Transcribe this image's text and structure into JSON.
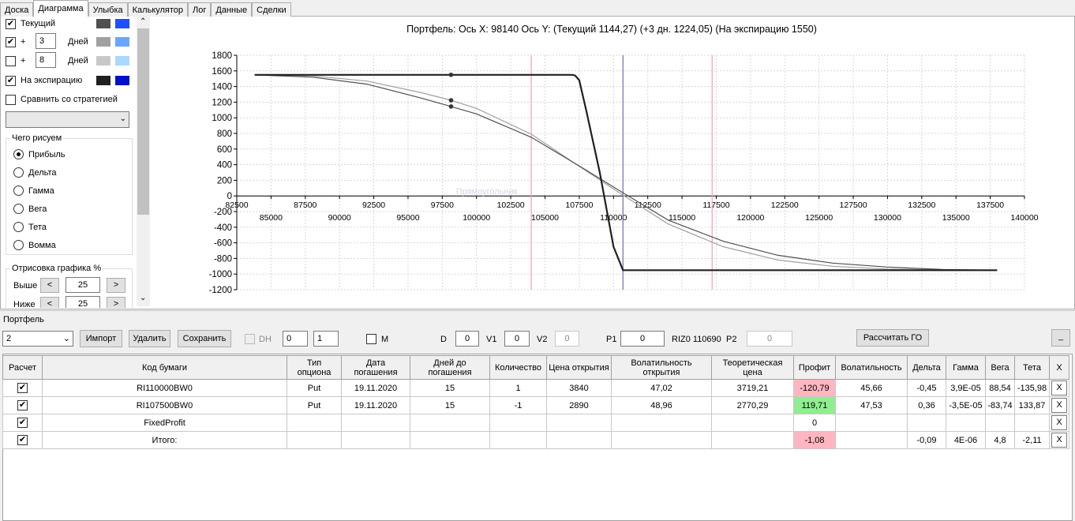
{
  "tabs": [
    "Доска",
    "Диаграмма",
    "Улыбка",
    "Калькулятор",
    "Лог",
    "Данные",
    "Сделки"
  ],
  "active_tab": 1,
  "left": {
    "current_label": "Текущий",
    "plus": "+",
    "days1": "3",
    "days2": "8",
    "days_label": "Дней",
    "expiry_label": "На экспирацию",
    "compare_label": "Сравнить со стратегией",
    "what_title": "Чего рисуем",
    "radios": [
      "Прибыль",
      "Дельта",
      "Гамма",
      "Вега",
      "Тета",
      "Вомма"
    ],
    "draw_title": "Отрисовка графика %",
    "above_label": "Выше",
    "below_label": "Ниже",
    "above_val": "25",
    "below_val": "25",
    "lt": "<",
    "gt": ">"
  },
  "colors": {
    "current": [
      "#505050",
      "#1f4fff"
    ],
    "plus3": [
      "#a0a0a0",
      "#6aa6ff"
    ],
    "plus8": [
      "#c8c8c8",
      "#aad8ff"
    ],
    "expiry": [
      "#202020",
      "#0010c8"
    ]
  },
  "chart_title": "Портфель: Ось X: 98140 Ось Y:  (Текущий 1144,27)  (+3 дн. 1224,05)  (На экспирацию 1550)",
  "chart_watermark": "Прямоугольник",
  "chart_data": {
    "type": "line",
    "title": "Портфель: Ось X: 98140 Ось Y:  (Текущий 1144,27)  (+3 дн. 1224,05)  (На экспирацию 1550)",
    "xlim": [
      82500,
      140000
    ],
    "ylim": [
      -1200,
      1800
    ],
    "x_ticks_upper": [
      "82500",
      "87500",
      "92500",
      "97500",
      "102500",
      "107500",
      "112500",
      "117500",
      "122500",
      "127500",
      "132500",
      "137500"
    ],
    "x_ticks_lower": [
      "85000",
      "90000",
      "95000",
      "100000",
      "105000",
      "110000",
      "115000",
      "120000",
      "125000",
      "130000",
      "135000",
      "140000"
    ],
    "y_ticks": [
      "1800",
      "1600",
      "1400",
      "1200",
      "1000",
      "800",
      "600",
      "400",
      "200",
      "0",
      "-200",
      "-400",
      "-600",
      "-800",
      "-1000",
      "-1200"
    ],
    "series": [
      {
        "key": "expiry",
        "x": [
          83800,
          107000,
          107200,
          107500,
          108000,
          109000,
          110000,
          110690,
          138000
        ],
        "y": [
          1550,
          1550,
          1540,
          1480,
          1100,
          300,
          -650,
          -950,
          -950
        ]
      },
      {
        "key": "current",
        "x": [
          83800,
          88000,
          92000,
          96000,
          98140,
          100000,
          104000,
          108000,
          110690,
          114000,
          118000,
          122000,
          126000,
          130000,
          134000,
          138000
        ],
        "y": [
          1548,
          1520,
          1430,
          1250,
          1144,
          1050,
          750,
          330,
          40,
          -310,
          -580,
          -760,
          -860,
          -910,
          -940,
          -950
        ]
      },
      {
        "key": "plus3",
        "x": [
          83800,
          88000,
          92000,
          96000,
          98140,
          100000,
          104000,
          108000,
          110690,
          114000,
          118000,
          122000,
          126000,
          130000,
          134000,
          138000
        ],
        "y": [
          1550,
          1535,
          1470,
          1320,
          1224,
          1120,
          790,
          320,
          10,
          -360,
          -650,
          -820,
          -900,
          -935,
          -948,
          -950
        ]
      }
    ],
    "markers": [
      {
        "x": 98140,
        "y": 1550
      },
      {
        "x": 98140,
        "y": 1224.05
      },
      {
        "x": 98140,
        "y": 1144.27
      }
    ],
    "vlines": [
      {
        "x": 104000,
        "color": "#f4a0b0"
      },
      {
        "x": 110690,
        "color": "#6e6ea0"
      },
      {
        "x": 117200,
        "color": "#f4a0b0"
      }
    ]
  },
  "portfolio": {
    "title": "Портфель",
    "select_val": "2",
    "import": "Импорт",
    "delete": "Удалить",
    "save": "Сохранить",
    "dh": "DH",
    "spin1": "0",
    "spin2": "1",
    "m": "M",
    "d_label": "D",
    "d_val": "0",
    "v1_label": "V1",
    "v1_val": "0",
    "v2_label": "V2",
    "v2_val": "0",
    "p1_label": "P1",
    "p1_val": "0",
    "riz_label": "RIZ0 110690",
    "p2_label": "P2",
    "p2_val": "0",
    "calc_go": "Рассчитать ГО",
    "min_btn": "_"
  },
  "table": {
    "headers": [
      "Расчет",
      "Код бумаги",
      "Тип опциона",
      "Дата погашения",
      "Дней до погашения",
      "Количество",
      "Цена открытия",
      "Волатильность открытия",
      "Теоретическая цена",
      "Профит",
      "Волатильность",
      "Дельта",
      "Гамма",
      "Вега",
      "Тета",
      "X"
    ],
    "rows": [
      [
        "✔",
        "RI110000BW0",
        "Put",
        "19.11.2020",
        "15",
        "1",
        "3840",
        "47,02",
        "3719,21",
        "-120,79",
        "45,66",
        "-0,45",
        "3,9E-05",
        "88,54",
        "-135,98",
        "X"
      ],
      [
        "✔",
        "RI107500BW0",
        "Put",
        "19.11.2020",
        "15",
        "-1",
        "2890",
        "48,96",
        "2770,29",
        "119,71",
        "47,53",
        "0,36",
        "-3,5E-05",
        "-83,74",
        "133,87",
        "X"
      ],
      [
        "✔",
        "FixedProfit",
        "",
        "",
        "",
        "",
        "",
        "",
        "",
        "0",
        "",
        "",
        "",
        "",
        "",
        "X"
      ],
      [
        "✔",
        "Итого:",
        "",
        "",
        "",
        "",
        "",
        "",
        "",
        "-1,08",
        "",
        "-0,09",
        "4E-06",
        "4,8",
        "-2,11",
        "X"
      ]
    ]
  }
}
